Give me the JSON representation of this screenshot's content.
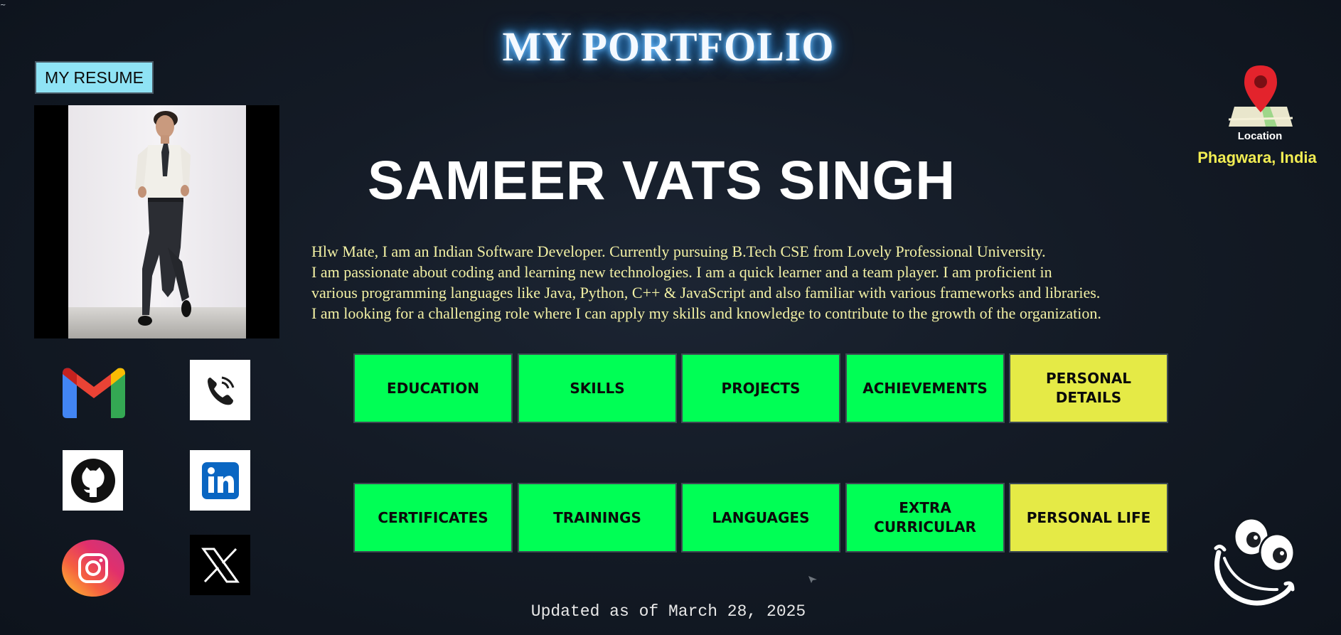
{
  "header": {
    "title": "MY PORTFOLIO",
    "corner_glyph": "~"
  },
  "resume": {
    "label": "MY RESUME"
  },
  "profile": {
    "name": "SAMEER VATS SINGH",
    "bio": [
      "Hlw Mate, I am an Indian Software Developer. Currently pursuing B.Tech CSE from Lovely Professional University.",
      "I am passionate about coding and learning new technologies. I am a quick learner and a team player. I am proficient in",
      "various programming languages like Java, Python, C++ & JavaScript and also familiar with various frameworks and libraries.",
      "I am looking for a challenging role where I can apply my skills and knowledge to contribute to the growth of the organization."
    ]
  },
  "location": {
    "label": "Location",
    "city": "Phagwara, India"
  },
  "social": [
    {
      "name": "gmail",
      "icon": "gmail-icon"
    },
    {
      "name": "phone",
      "icon": "phone-icon"
    },
    {
      "name": "github",
      "icon": "github-icon"
    },
    {
      "name": "linkedin",
      "icon": "linkedin-icon"
    },
    {
      "name": "instagram",
      "icon": "instagram-icon"
    },
    {
      "name": "x",
      "icon": "x-twitter-icon"
    }
  ],
  "sections": {
    "row1": [
      {
        "line1": "EDUCATION",
        "line2": ""
      },
      {
        "line1": "SKILLS",
        "line2": ""
      },
      {
        "line1": "PROJECTS",
        "line2": ""
      },
      {
        "line1": "ACHIEVEMENTS",
        "line2": ""
      },
      {
        "line1": "PERSONAL",
        "line2": "DETAILS"
      }
    ],
    "row2": [
      {
        "line1": "CERTIFICATES",
        "line2": ""
      },
      {
        "line1": "TRAININGS",
        "line2": ""
      },
      {
        "line1": "LANGUAGES",
        "line2": ""
      },
      {
        "line1": "EXTRA",
        "line2": "CURRICULAR"
      },
      {
        "line1": "PERSONAL LIFE",
        "line2": ""
      }
    ]
  },
  "footer": {
    "updated": "Updated as of March 28, 2025"
  },
  "colors": {
    "button_green": "#00ff55",
    "button_yellow": "#e5ea46",
    "bio_text": "#f3f1a4",
    "city_text": "#f1ec52",
    "resume_button": "#8fe3f5"
  }
}
